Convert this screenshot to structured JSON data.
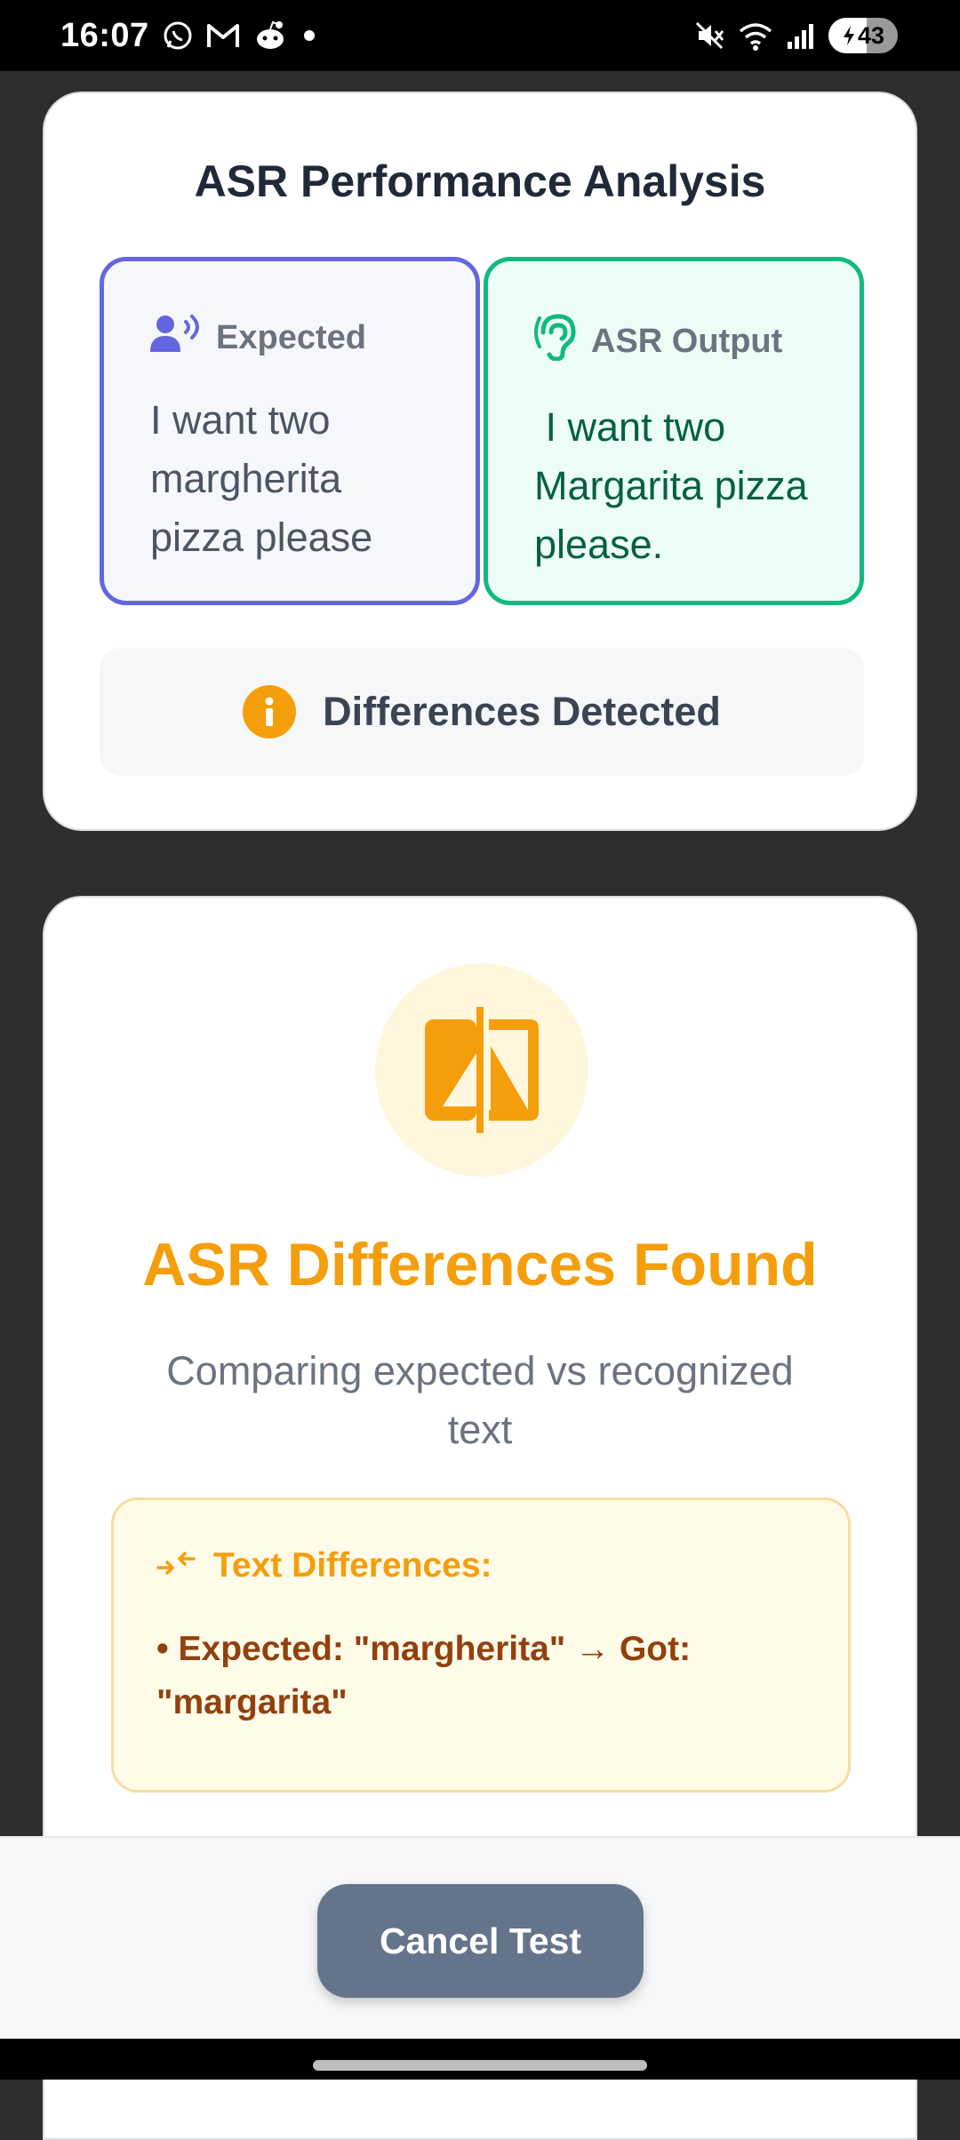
{
  "status_bar": {
    "time": "16:07",
    "battery_level": "43",
    "icons_left": [
      "whatsapp-icon",
      "gmail-icon",
      "reddit-icon",
      "dot-icon"
    ],
    "icons_right": [
      "mute-icon",
      "wifi-icon",
      "signal-icon",
      "battery-icon"
    ]
  },
  "analysis": {
    "title": "ASR Performance Analysis",
    "expected": {
      "label": "Expected",
      "text": "I want two margherita pizza please",
      "icon": "speaking-person-icon",
      "accent_color": "#6466e0"
    },
    "asr_output": {
      "label": "ASR Output",
      "text": " I want two Margarita pizza please.",
      "icon": "ear-icon",
      "accent_color": "#10b981"
    },
    "banner": {
      "label": "Differences Detected",
      "icon": "info-icon",
      "color": "#f59e0b"
    }
  },
  "result": {
    "icon": "compare-icon",
    "title": "ASR Differences Found",
    "subtitle": "Comparing expected vs recognized text",
    "differences": {
      "heading": "Text Differences:",
      "icon": "merge-arrows-icon",
      "items": [
        "• Expected: \"margherita\" → Got: \"margarita\""
      ]
    }
  },
  "actions": {
    "cancel_label": "Cancel Test"
  }
}
